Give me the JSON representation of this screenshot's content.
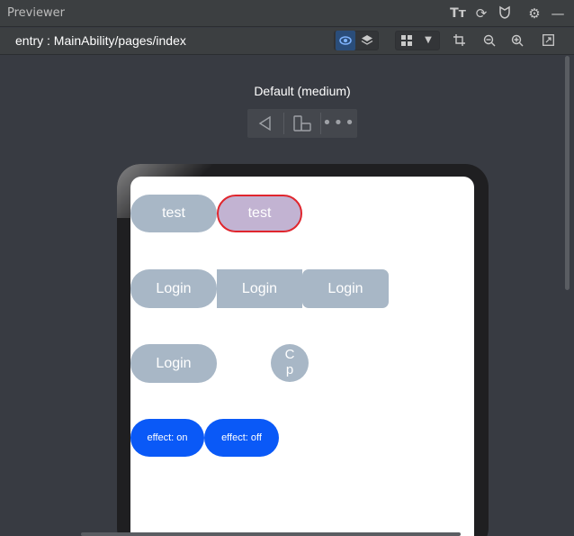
{
  "window": {
    "title": "Previewer"
  },
  "toolbar_icons": [
    "font-size-icon",
    "refresh-icon",
    "inspector-icon",
    "settings-icon",
    "minimize-icon"
  ],
  "path": {
    "text": "entry : MainAbility/pages/index"
  },
  "device": {
    "label": "Default (medium)"
  },
  "buttons": {
    "row1": [
      "test",
      "test"
    ],
    "row2": [
      "Login",
      "Login",
      "Login"
    ],
    "row3_login": "Login",
    "circle_line1": "C",
    "circle_line2": "p",
    "effect_on": "effect: on",
    "effect_off": "effect: off"
  },
  "colors": {
    "button_gray": "#a8b7c6",
    "button_selected": "#c2b3d2",
    "selection_border": "#e0262e",
    "button_blue": "#0a59f7"
  }
}
